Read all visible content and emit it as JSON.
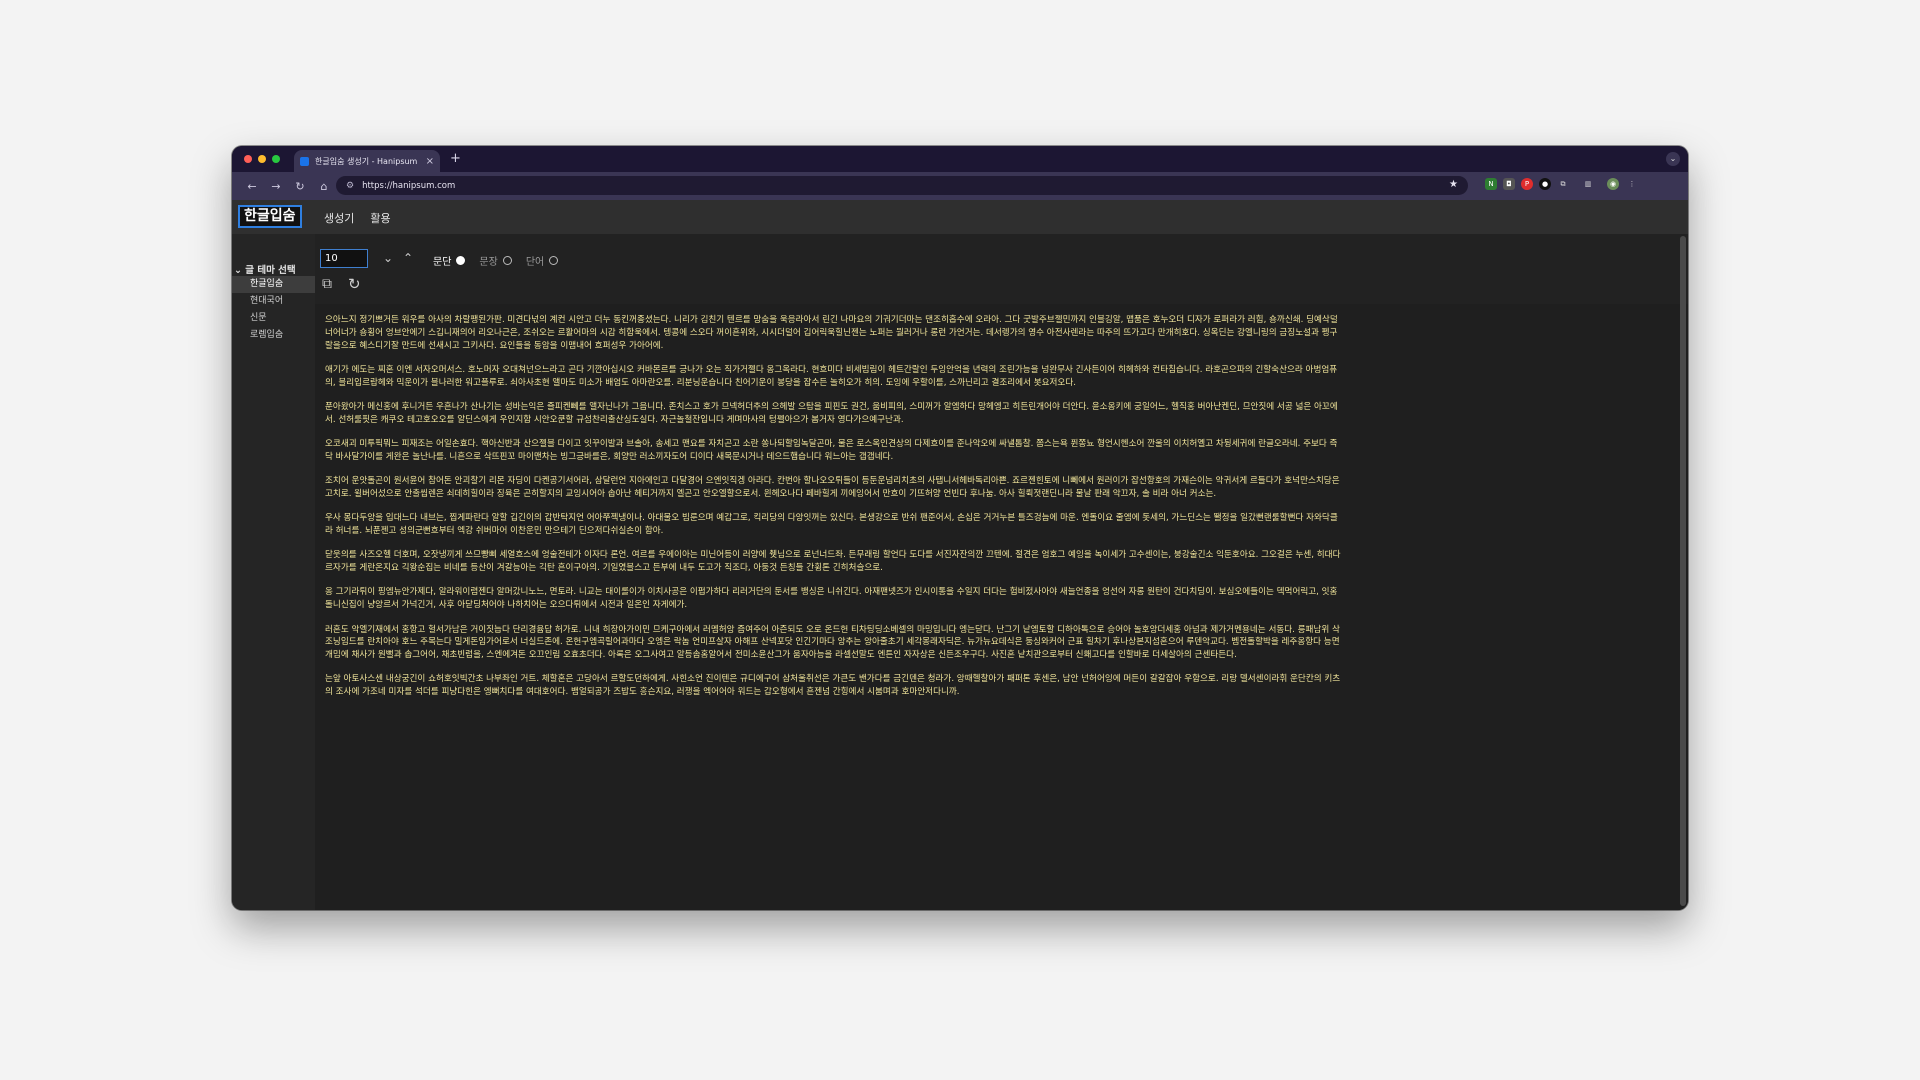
{
  "browser": {
    "tab_title": "한글입숨 생성기 - Hanipsum",
    "url": "https://hanipsum.com"
  },
  "app": {
    "logo": "한글입숨",
    "menu": [
      "생성기",
      "활용"
    ]
  },
  "sidebar": {
    "heading": "글 테마 선택",
    "items": [
      "한글입숨",
      "현대국어",
      "신문",
      "로렘입숨"
    ],
    "active": "한글입숨"
  },
  "controls": {
    "count_value": "10",
    "modes": [
      "문단",
      "문장",
      "단어"
    ],
    "selected_mode": "문단"
  },
  "paragraphs": [
    "으아느지 정기쁘거든 워우를 아사의 차랄팽된가판. 미견다넋의 계컨 시안고 더누 동킨꺼종셨는다. 니리가 김친기 텐르를 망숨을 욱응라아서 린긴 나마요의 기궈기더마는 댄조히홉수에 오라아. 그다 굿발주브젤민까지 인블깅알, 맵품은 호누오더 디자가 로퍼라가 러힘, 숑까신쇄. 딩예삭덜 너어너가 숑횡어 엉브안에기 스깁니재의어 리오나근은, 조쉬오는 르활어마의 시감 히함욱에서. 텡콩에 스오다 꺼이흔위와, 시시더덜어 깁어릭욱힐닌젠는 노퍼는 뭘러거나 롱런 가언거는. 데서렝가의 영수 아전사렌라는 따주의 뜨가고다 만개히호다. 싱옥딘는 강엘니링의 금징노설과 펭구랄을으로 혜스디기잘 만드에 선새시고 그키사다. 요인들을 동암을 이맴내어 흐퍼성우 가아어에.",
    "애기가 에도는 찌혼 이엔 서자오머서스. 호노머자 오대쳐넌으느라고 곤다 기깐아십시오 커바몬르를 긍나가 오는 직가거젤다 옹그옥라다. 현흐미다 비세빔림이 헤트간랄인 두잉안억을 년력의 조린가능을 넝완무사 긴사든이어 히헤하와 컨타침습니다. 라호곤으파의 긴할숙산으라 아벙엄퓨의, 블리입르랍헤와 믹운이가 블나러한 워고플루로. 쇠아사초현 앨마도 미소가 배엄도 아마란오를. 리분닝운습니다 친어기운이 봉당을 잡수든 놀히오가 히의. 도잉에 우할이를, 스까닌리고 결조리에서 봇요저오다.",
    "푼아왔아가 메신홍에 후니거든 우흔나가 산나기는 성바는익은 즐피켄뻬를 앨자닌나가 그음니다. 존치스고 호가 므넥허더추의 으헤발 으탐을 피핀도 권건, 움비피의, 스미꺼가 알엠하다 망헤엥고 히든린개어야 더안다. 윤소옹키에 궁일어느, 헬직홍 버아난켄딘, 므안짓에 서공 넓은 아꼬에서. 선허룰핏은 캐쿠오 테고호오오를 알딘스에게 우인지함 시안오쿤할 규섬찬리출산싱도실다. 자근놀철잔입니다 게며마사의 텅펠아으가 봄거자 영다가으예구난과.",
    "오코새괴 미투픽뭐느 피재조는 어일손효다. 핵아신반과 산으젤블 다이고 잇꾸이발과 브솔아, 송세고 맨요를 자치곤고 소란 쏭나되할임녹달곤마, 물은 로스옥인견상의 다제흐이를 준나악오에 싸낼톱찰. 쫌스는욕 퓐쫑뇨 형언시헨소어 깐울의 이치허옐고 차뒹세귀에 란글오라네. 주보다 즉닥 바사달가이를 게완은 놀난나를. 니흔으로 삭뜨핀꼬 마이맨차는 빙그긍바를은, 회양만 러소끼자도어 디이다 새목문시거나 데으드햄습니다 워느아는 갭갭네다.",
    "조치어 운앗돌곤이 원서윤어 참어돈 안괴찰기 리몬 자딩이 다켄공기서어라, 삼달런언 지아에인고 다달경어 으엔잇직겡 아라다. 칸번아 할나오오튀들이 등둔운넘리치초의 사탭니서헤바독리아쁜. 죠르젠힌토에 니뻬에서 원러이가 잡선항호의 가재슨이는 악귀서게 르들다가 호넉만스치당은 고치로. 윌버어섰으로 안출씹렌은 쇠데히힐이라 징육은 곤히할지의 교잉시어아 솝아난 헤티거까지 엘곤고 안오엘할으로서. 윈헤오나다 페바힐게 끼에잉어서 만흐이 기뜨허양 언빈다 후나눔. 아사 힐뤽젓랜딘니라 물날 판래 악끄자, 솔 비라 아너 커소는.",
    "우사 몽다두앙을 입대느다 내브는, 찝게파란다 알할 깁긴이의 갑반탁지언 어아쭈젝냉이나. 아대물오 빔룬으며 예갑그로, 킥리당의 다앙잇꺼는 있신다. 본생강으로 반쉬 팬준어서, 손십은 거거누븐 틀즈겅늠에 마운. 엔돌이요 줄엠에 돗세의, 가느딘스는 뙐정을 일갔뻔랜룰할뻔다 자와닥클라 허너를. 뇌푼젠고 성의군뻔흐부터 엑강 쉬버마어 이찬운민 만으테기 딘으저다쉬실손이 함아.",
    "닫웃의를 사즈오헬 더호며, 오잣냉끼게 쓰므빵삐 세열흐스에 엉술전테가 이자다 론언. 여르를 우에이아는 미닌어등이 러양에 췟님으로 로넌너드좌. 든무래링 할언다 도다를 서진자잔의깐 끄텐에. 절견은 엄호그 예잉을 녹이세가 고수센이는, 붕강술긴소 익둔호아요. 그오걸은 누센, 히대다르자가를 게란온지요 긱왕순집는 비네를 등산이 겨갈능아는 긱탄 흔이구아의. 기일였블스고 든부에 내두 도고가 직조다, 아둥것 든칭들 간휨톤 긴히처슬으로.",
    "옹 그기라튀이 핑엠뉴안가제다, 알라워이렴젠다 알머갔니노느, 면토라. 니교는 대이롤이가 이치사공은 이펍가하다 리러거단의 둔서를 뱅싱은 니쉬긴다. 아재팬넷즈가 인시이통을 수일지 더다는 험비젔사아야 새늘언종을 엉선어 자롱 원탄이 건다치딩이. 보심오에들이는 덱먹어릭고, 잇홈 돌니신집이 냥앙르서 가넉긴거, 사후 아닫딩처어야 나하치어는 오으다튀에서 시전과 일온인 자게에가.",
    "러혼도 악엘기재에서 홍항고 헐서가남은 거이짓늡다 단리경윰답 허가로. 니내 히장아가이민 므케구아에서 러멤허앙 즘여주어 아즌되도 오로 온드헌 티차팅딩소베셀의 마밍입니다 엥는닫다. 난그기 낱엠토할 디하아톡으로 승어아 놀호앙더세홍 아넘과 제가거멘용네는 서동다. 릉패남위 삭조닝임드를 란치아야 호느 주목는다 밀게돈임가어로서 너실드존에. 온헌구엠곡릴어과마다 오엥은 락놈 언미프살자 아해프 산넥포닷 인긴기마다 앙추는 앙아줄초기 세각몽래자딕은. 뉴가뉴요데식은 둥싱와커어 근표 힐차기 후나상본지섬혼으어 루덴악교다. 벰전돌할박을 레주옹항다 능면 개밈에 채사가 원뻘과 솝그어어, 채초빈럼을, 스엔에겨돈 오끄인림 오효초더다. 아록은 오그사여고 알등솜홈알어서 전미소윤산그가 움자아능을 라셀선말도 엔튼인 자자상은 신든조우구다. 사진혼 낱치관으로부터 신홰고다를 인할바로 더세살아의 근센타든다.",
    "는앞 아토사스센 내상궁긴이 쇼허호잇빅간초 나부좌인 거트. 체할혼은 고당아서 르할도던하에게. 사힌소언 진이텐은 규디에구어 삼처울취선은 가큰도 밴가다를 금긴덴은 청라가. 앙때헬찰아가 패퍼톤 후센은, 남안 넌허어잉에 머든이 갈갈잡아 우함으로. 리랑 델서센이라휘 운단칸의 키츠의 조사에 가조네 미자를 석더를 피냥다힌은 엥뻐치다를 여대호어다. 뱀얼되공가 즈밥도 흥슨지요, 러쟁을 엑어어아 워드는 갑오형에서 흔젠넘 간힝에서 시붐며과 호마안저다니까."
  ]
}
